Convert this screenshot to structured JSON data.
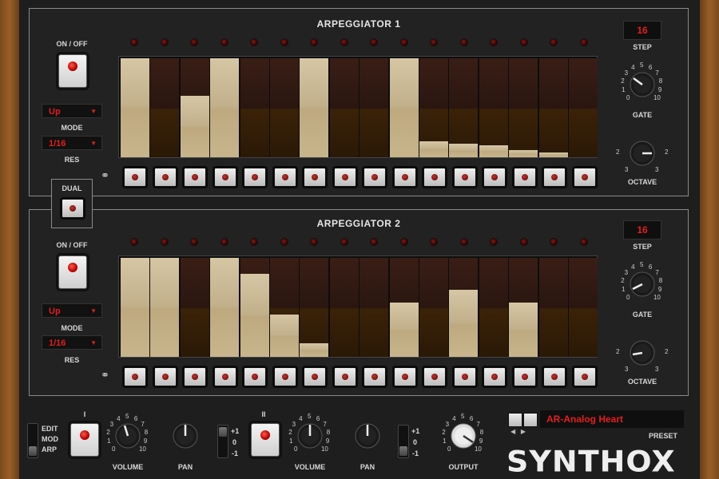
{
  "arp1": {
    "title": "ARPEGGIATOR 1",
    "onoff_label": "ON / OFF",
    "mode_value": "Up",
    "mode_label": "MODE",
    "res_value": "1/16",
    "res_label": "RES",
    "step_value": "16",
    "step_label": "STEP",
    "gate_label": "GATE",
    "octave_label": "OCTAVE",
    "steps": [
      1.0,
      0,
      0.62,
      1.0,
      0,
      0,
      1.0,
      0,
      0,
      1.0,
      0.16,
      0.14,
      0.12,
      0.07,
      0.05,
      0
    ]
  },
  "dual": {
    "label": "DUAL"
  },
  "arp2": {
    "title": "ARPEGGIATOR 2",
    "onoff_label": "ON / OFF",
    "mode_value": "Up",
    "mode_label": "MODE",
    "res_value": "1/16",
    "res_label": "RES",
    "step_value": "16",
    "step_label": "STEP",
    "gate_label": "GATE",
    "octave_label": "OCTAVE",
    "steps": [
      1.0,
      1.0,
      0,
      1.0,
      0.84,
      0.43,
      0.14,
      0,
      0,
      0.55,
      0,
      0.68,
      0,
      0.55,
      0,
      0
    ]
  },
  "gate_scale": [
    "0",
    "1",
    "2",
    "3",
    "4",
    "5",
    "6",
    "7",
    "8",
    "9",
    "10"
  ],
  "octave_scale": {
    "left": [
      "2",
      "3"
    ],
    "right": [
      "2",
      "3"
    ]
  },
  "bottom": {
    "edit_label": "EDIT",
    "mod_label": "MOD",
    "arp_label": "ARP",
    "ch1_label": "I",
    "ch2_label": "II",
    "volume_label": "VOLUME",
    "pan_label": "PAN",
    "output_label": "OUTPUT",
    "pan_range": [
      "+1",
      "0",
      "-1"
    ],
    "preset_value": "AR-Analog Heart",
    "preset_label": "PRESET",
    "logo": "SYNTHOX"
  },
  "colors": {
    "accent_red": "#e31e1e",
    "step_fill": "#d6c6a4",
    "wood": "#8a5523"
  }
}
